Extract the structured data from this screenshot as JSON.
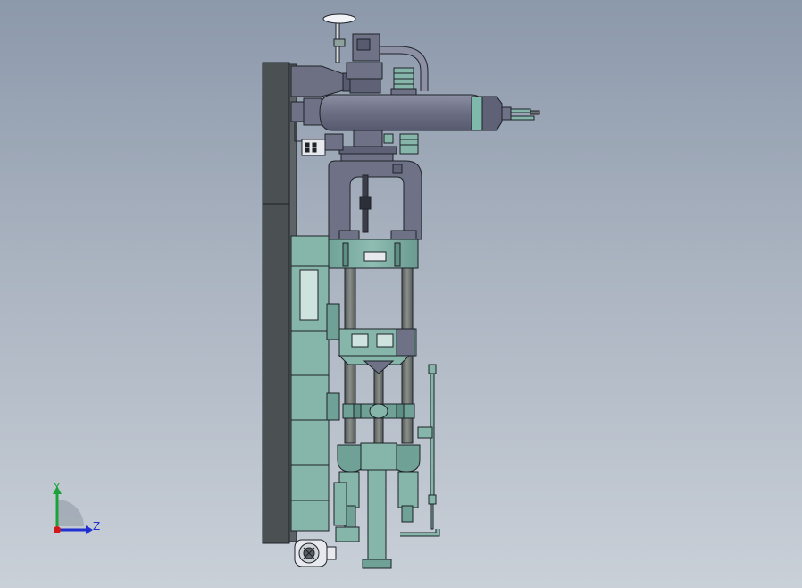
{
  "viewport": {
    "background_top": "#8c99ab",
    "background_bottom": "#c9d0d8"
  },
  "colors": {
    "teal": "#86b5aa",
    "teal_dark": "#5e8f85",
    "slate": "#6f7186",
    "slate_dark": "#4f5165",
    "plate": "#4a4f52",
    "rod": "#6e736f",
    "light": "#e8e9ee",
    "edge": "#1d2228"
  },
  "triad": {
    "y_label": "Y",
    "z_label": "Z",
    "y_color": "#1aa33a",
    "z_color": "#1f2fd0",
    "origin_color": "#d01818"
  }
}
